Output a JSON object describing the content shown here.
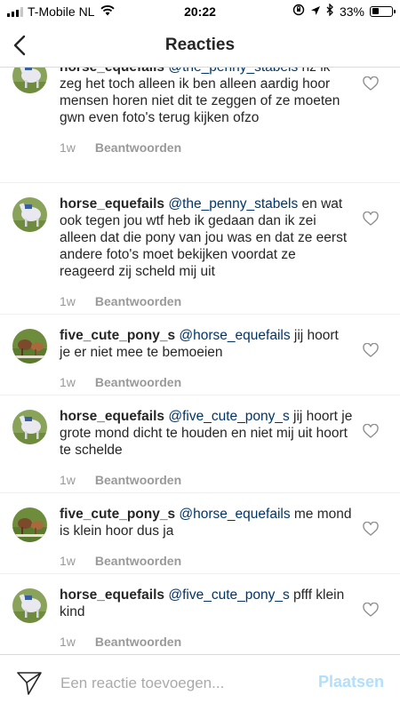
{
  "status_bar": {
    "carrier": "T-Mobile NL",
    "time": "20:22",
    "battery_percent_label": "33%",
    "battery_level": 0.33,
    "signal_bars_active": 3
  },
  "header": {
    "title": "Reacties",
    "back_icon": "chevron-left-icon"
  },
  "comments": [
    {
      "username": "horse_equefails",
      "mention": "@the_penny_stabels",
      "text": " hz ik zeg het toch alleen ik ben alleen aardig hoor mensen horen niet dit te zeggen of ze moeten gwn even foto's terug kijken ofzo",
      "time": "1w",
      "reply_label": "Beantwoorden"
    },
    {
      "username": "horse_equefails",
      "mention": "@the_penny_stabels",
      "text": " en wat ook tegen jou wtf heb ik gedaan dan ik zei alleen dat die pony van jou was en dat ze eerst andere foto's moet bekijken voordat ze reageerd zij scheld mij uit",
      "time": "1w",
      "reply_label": "Beantwoorden"
    },
    {
      "username": "five_cute_pony_s",
      "mention": "@horse_equefails",
      "text": " jij hoort je er niet mee te bemoeien",
      "time": "1w",
      "reply_label": "Beantwoorden"
    },
    {
      "username": "horse_equefails",
      "mention": "@five_cute_pony_s",
      "text": " jij hoort je grote mond dicht te houden en niet mij uit hoort te schelde",
      "time": "1w",
      "reply_label": "Beantwoorden"
    },
    {
      "username": "five_cute_pony_s",
      "mention": "@horse_equefails",
      "text": " me mond is klein hoor dus ja",
      "time": "1w",
      "reply_label": "Beantwoorden"
    },
    {
      "username": "horse_equefails",
      "mention": "@five_cute_pony_s",
      "text": " pfff klein kind",
      "time": "1w",
      "reply_label": "Beantwoorden"
    }
  ],
  "composer": {
    "placeholder": "Een reactie toevoegen...",
    "value": "",
    "post_label": "Plaatsen"
  },
  "colors": {
    "mention": "#003569",
    "muted": "#999999",
    "post_disabled": "#b2dffc"
  }
}
